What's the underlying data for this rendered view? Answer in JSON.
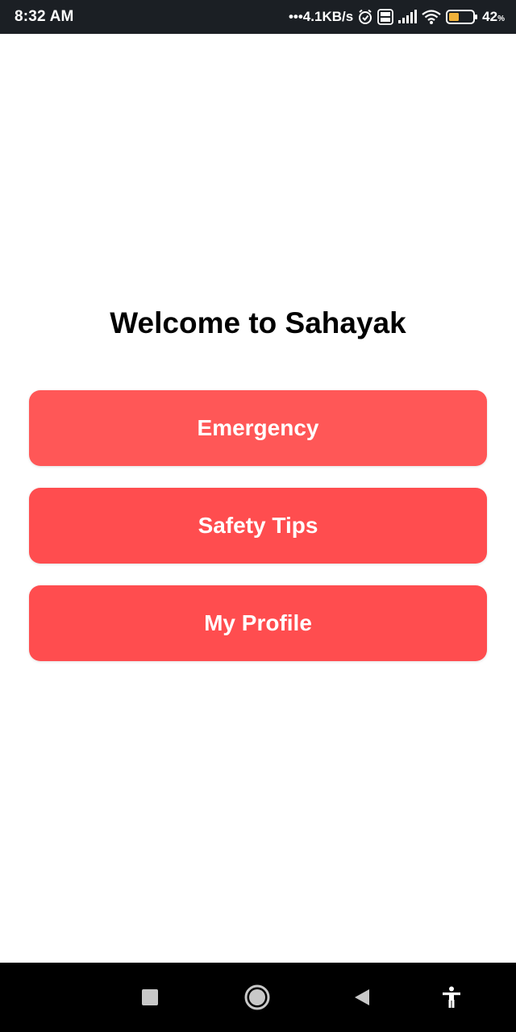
{
  "status_bar": {
    "time": "8:32 AM",
    "network_speed": "•••4.1KB/s",
    "icons": [
      "alarm-icon",
      "volte-icon",
      "signal-icon",
      "wifi-icon",
      "battery-icon"
    ],
    "battery_percent": "42",
    "battery_unit": "%"
  },
  "main": {
    "title": "Welcome to Sahayak",
    "buttons": [
      {
        "label": "Emergency"
      },
      {
        "label": "Safety Tips"
      },
      {
        "label": "My Profile"
      }
    ]
  },
  "colors": {
    "accent": "#ff5757",
    "status_bar_bg": "#1b1f24",
    "nav_bar_bg": "#000000"
  },
  "nav_bar": {
    "icons": [
      "recents-icon",
      "home-icon",
      "back-icon",
      "accessibility-icon"
    ]
  }
}
